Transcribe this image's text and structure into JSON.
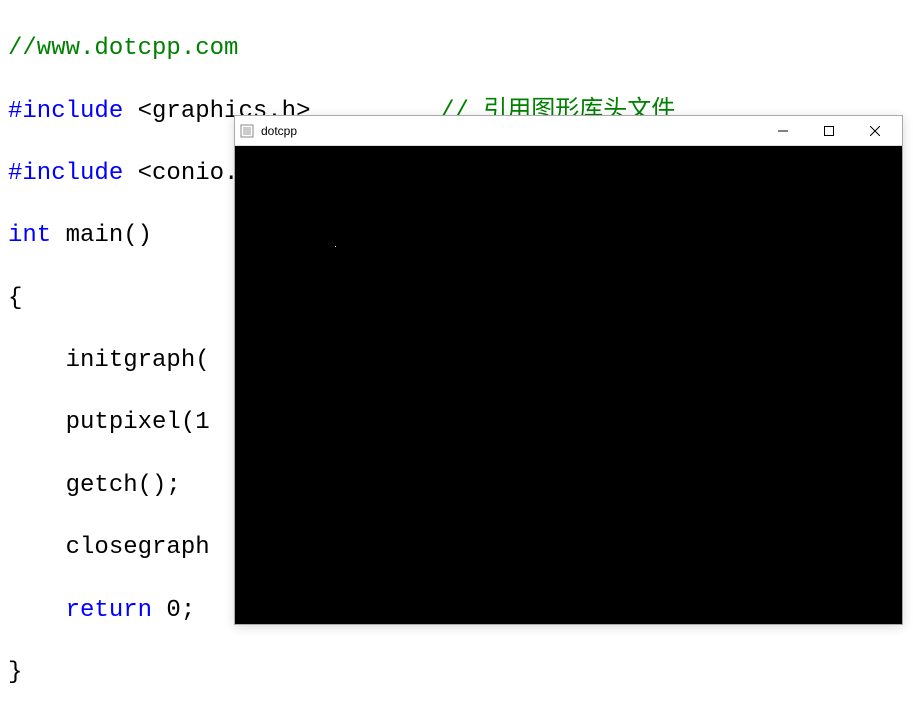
{
  "code": {
    "line1_comment": "//www.dotcpp.com",
    "line2_include": "#include",
    "line2_open": " <",
    "line2_file": "graphics.h",
    "line2_close": ">",
    "line2_comment": "// 引用图形库头文件",
    "line3_include": "#include",
    "line3_open": " <",
    "line3_file": "conio.h",
    "line3_close": ">",
    "line4_int": "int",
    "line4_main": " main()",
    "line5_brace": "{",
    "line6_indent": "    ",
    "line6_call": "initgraph(",
    "line7_indent": "    ",
    "line7_call": "putpixel(1",
    "line8_indent": "    ",
    "line8_call": "getch();",
    "line9_indent": "    ",
    "line9_call": "closegraph",
    "line10_indent": "    ",
    "line10_return": "return",
    "line10_val": " 0;",
    "line11_brace": "}"
  },
  "window": {
    "title": "dotcpp",
    "minimize": "—",
    "maximize": "□",
    "close": "✕"
  }
}
